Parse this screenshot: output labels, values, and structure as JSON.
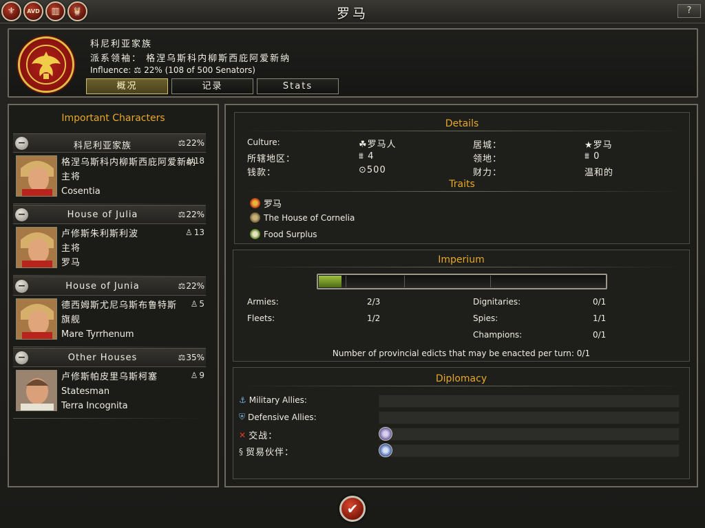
{
  "window": {
    "title": "罗马",
    "help_label": "?"
  },
  "top_icons": [
    {
      "name": "faction-icon",
      "glyph": "⚜"
    },
    {
      "name": "avd-icon",
      "glyph": "AVD"
    },
    {
      "name": "book-icon",
      "glyph": "▥"
    },
    {
      "name": "owl-icon",
      "glyph": "🦉"
    }
  ],
  "faction": {
    "name": "科尼利亚家族",
    "leader_label": "派系领袖：",
    "leader_name": "格涅乌斯科内柳斯西庇阿爱新纳",
    "influence_label": "Influence:",
    "influence_value": "22% (108 of 500 Senators)"
  },
  "tabs": [
    {
      "label": "概况",
      "active": true
    },
    {
      "label": "记录",
      "active": false
    },
    {
      "label": "Stats",
      "active": false
    }
  ],
  "characters_panel": {
    "heading": "Important Characters",
    "groups": [
      {
        "name": "科尼利亚家族",
        "value": "22%",
        "char": {
          "name": "格涅乌斯科内柳斯西庇阿爱新纳",
          "role": "主将",
          "location": "Cosentia",
          "stat": "18"
        }
      },
      {
        "name": "House of Julia",
        "value": "22%",
        "char": {
          "name": "卢修斯朱利斯利波",
          "role": "主将",
          "location": "罗马",
          "stat": "13"
        }
      },
      {
        "name": "House of Junia",
        "value": "22%",
        "char": {
          "name": "德西姆斯尤尼乌斯布鲁特斯",
          "role": "旗舰",
          "location": "Mare Tyrrhenum",
          "stat": "5"
        }
      },
      {
        "name": "Other Houses",
        "value": "35%",
        "char": {
          "name": "卢修斯帕皮里乌斯柯塞",
          "role": "Statesman",
          "location": "Terra Incognita",
          "stat": "9"
        }
      }
    ]
  },
  "details": {
    "heading": "Details",
    "culture_label": "Culture:",
    "culture_value": "罗马人",
    "regions_label": "所辖地区：",
    "regions_value": "4",
    "money_label": "钱款：",
    "money_value": "500",
    "capital_label": "居城：",
    "capital_value": "罗马",
    "territory_label": "领地：",
    "territory_value": "0",
    "wealth_label": "财力：",
    "wealth_value": "温和的",
    "traits_heading": "Traits",
    "traits": [
      {
        "label": "罗马",
        "color": "#c4411f"
      },
      {
        "label": "The House of Cornelia",
        "color": "#8a7a4d"
      },
      {
        "label": "Food Surplus",
        "color": "#6c9b2a"
      }
    ]
  },
  "imperium": {
    "heading": "Imperium",
    "progress": 0.08,
    "armies_label": "Armies:",
    "armies_value": "2/3",
    "fleets_label": "Fleets:",
    "fleets_value": "1/2",
    "dignitaries_label": "Dignitaries:",
    "dignitaries_value": "0/1",
    "spies_label": "Spies:",
    "spies_value": "1/1",
    "champions_label": "Champions:",
    "champions_value": "0/1",
    "edicts_text": "Number of provincial edicts that may be enacted per turn: 0/1"
  },
  "diplomacy": {
    "heading": "Diplomacy",
    "military_allies_label": "Military Allies:",
    "defensive_allies_label": "Defensive Allies:",
    "war_label": "交战：",
    "trade_label": "贸易伙伴：",
    "war_badge_color": "#6b5a9b",
    "trade_badge_color": "#3a5aa0"
  },
  "colors": {
    "accent": "#e8a928",
    "panel_border": "#6c695e"
  }
}
